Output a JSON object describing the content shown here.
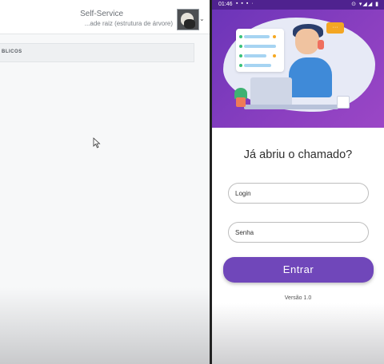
{
  "left_app": {
    "header": {
      "title": "Self-Service",
      "subtitle": "...ade raiz (estrutura de árvore)"
    },
    "section_label": "BLICOS"
  },
  "phone": {
    "status_bar": {
      "time": "01:46"
    },
    "illustration": {
      "bubble_text": "···"
    },
    "question": "Já abriu o chamado?",
    "login": {
      "placeholder": "Login"
    },
    "password": {
      "placeholder": "Senha"
    },
    "submit_label": "Entrar",
    "version": "Versão 1.0",
    "colors": {
      "primary": "#7047ba",
      "hero": "#8a3fc0"
    }
  }
}
